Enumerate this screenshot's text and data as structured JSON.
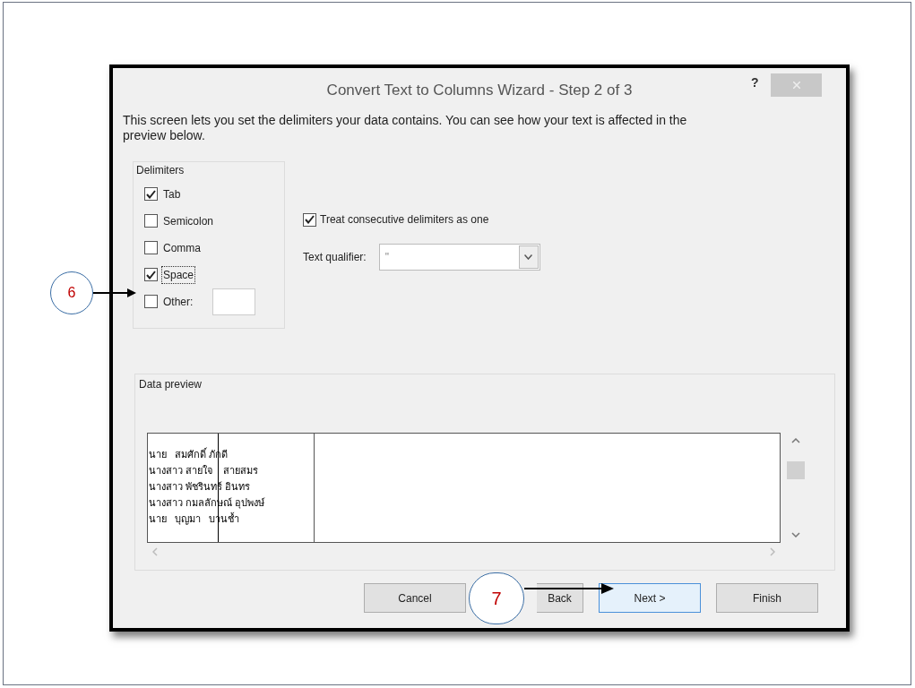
{
  "window": {
    "title": "Convert Text to Columns Wizard - Step 2 of 3",
    "help": "?"
  },
  "intro": "This screen lets you set the delimiters your data contains.  You can see how your text is affected in the preview below.",
  "delimiters": {
    "label": "Delimiters",
    "items": [
      {
        "label": "Tab",
        "checked": true,
        "focused": false
      },
      {
        "label": "Semicolon",
        "checked": false,
        "focused": false
      },
      {
        "label": "Comma",
        "checked": false,
        "focused": false
      },
      {
        "label": "Space",
        "checked": true,
        "focused": true
      },
      {
        "label": "Other:",
        "checked": false,
        "focused": false,
        "kind": "with-field"
      }
    ]
  },
  "consecutive": {
    "label": "Treat consecutive delimiters as one",
    "checked": true
  },
  "qualifier": {
    "label": "Text qualifier:",
    "value": "\""
  },
  "preview": {
    "label": "Data preview",
    "rows": [
      "นาย   สมศักดิ์ ภักดี",
      "นางสาว สายใจ    สายสมร",
      "นางสาว พัชรินทร์ อินทร",
      "นางสาว กมลลักษณ์ อุปพงษ์",
      "นาย   บุญมา   บานช้ำ"
    ]
  },
  "buttons": [
    {
      "label": "Cancel",
      "default": false
    },
    {
      "label": "Back",
      "default": false
    },
    {
      "label": "Next >",
      "default": true
    },
    {
      "label": "Finish",
      "default": false
    }
  ],
  "annotations": [
    {
      "label": "6"
    },
    {
      "label": "7"
    }
  ]
}
